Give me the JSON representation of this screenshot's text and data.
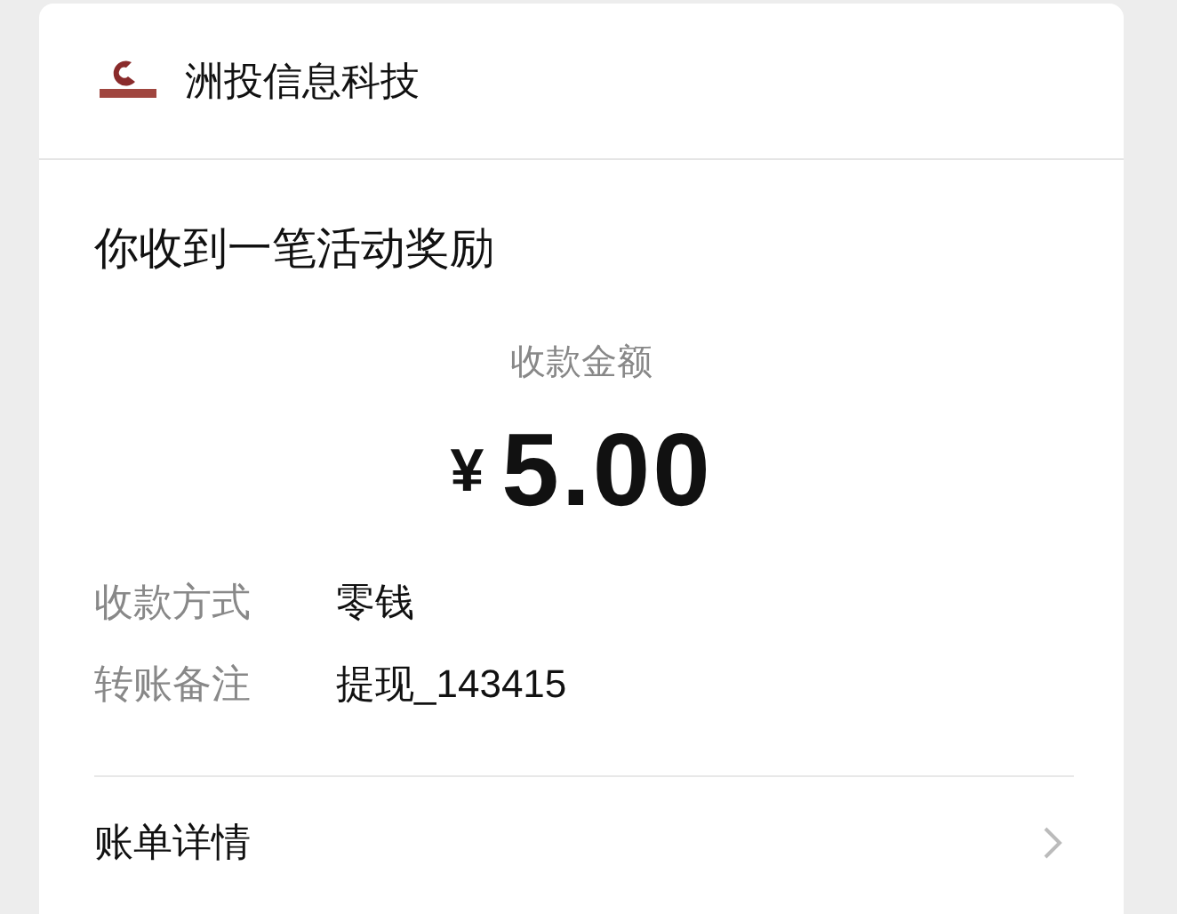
{
  "header": {
    "merchant": "洲投信息科技"
  },
  "title": "你收到一笔活动奖励",
  "amount": {
    "label": "收款金额",
    "currency": "¥",
    "value": "5.00"
  },
  "details": [
    {
      "label": "收款方式",
      "value": "零钱"
    },
    {
      "label": "转账备注",
      "value": "提现_143415"
    }
  ],
  "bill_link": {
    "label": "账单详情"
  }
}
